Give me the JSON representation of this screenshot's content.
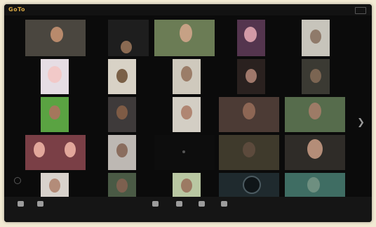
{
  "app": {
    "logo": "GoTo",
    "logo_sub": "",
    "caption": "",
    "accent": "#d7a743"
  },
  "tiles": [
    {
      "id": "t1",
      "name": ""
    },
    {
      "id": "t2",
      "name": ""
    },
    {
      "id": "t3",
      "name": ""
    },
    {
      "id": "t4",
      "name": ""
    },
    {
      "id": "t5",
      "name": ""
    },
    {
      "id": "t6",
      "name": ""
    },
    {
      "id": "t7",
      "name": ""
    },
    {
      "id": "t8",
      "name": ""
    },
    {
      "id": "t9",
      "name": ""
    },
    {
      "id": "t10",
      "name": ""
    },
    {
      "id": "t11",
      "name": ""
    },
    {
      "id": "t12",
      "name": ""
    },
    {
      "id": "t13",
      "name": ""
    },
    {
      "id": "t14",
      "name": ""
    },
    {
      "id": "t15",
      "name": ""
    },
    {
      "id": "t16",
      "name": ""
    },
    {
      "id": "t17",
      "name": ""
    },
    {
      "id": "t18",
      "name": ""
    },
    {
      "id": "t19",
      "name": ""
    },
    {
      "id": "t20",
      "name": ""
    },
    {
      "id": "t21",
      "name": ""
    },
    {
      "id": "t22",
      "name": ""
    },
    {
      "id": "t23",
      "name": ""
    },
    {
      "id": "t24",
      "name": ""
    },
    {
      "id": "t25",
      "name": ""
    }
  ],
  "toolbar": {
    "items": [
      {
        "label": "",
        "icon": "microphone-icon"
      },
      {
        "label": "",
        "icon": "video-camera-icon"
      },
      {
        "label": "",
        "icon": "share-screen-icon"
      },
      {
        "label": "",
        "icon": "record-icon"
      },
      {
        "label": "",
        "icon": "participants-icon"
      },
      {
        "label": "",
        "icon": "more-icon"
      }
    ],
    "end_label": ""
  }
}
